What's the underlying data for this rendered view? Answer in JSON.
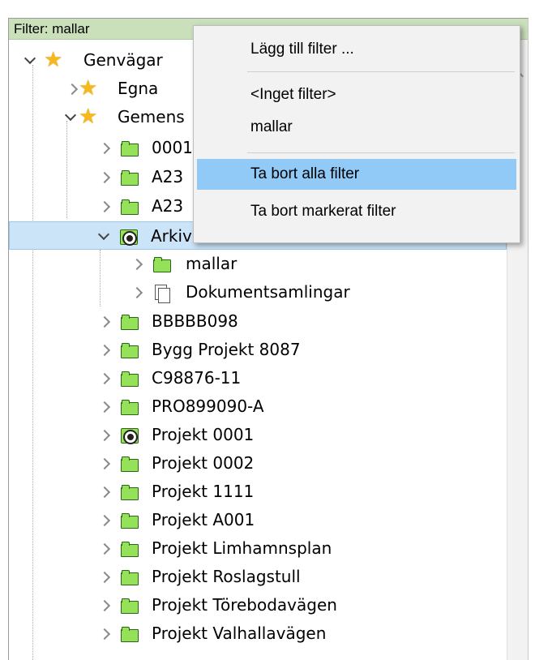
{
  "filter_bar": {
    "text": "Filter: mallar"
  },
  "context_menu": {
    "items": [
      {
        "label": "Lägg till filter ..."
      },
      {
        "label": "<Inget filter>"
      },
      {
        "label": "mallar"
      },
      {
        "label": "Ta bort alla filter",
        "highlighted": true
      },
      {
        "label": "Ta bort markerat filter"
      }
    ]
  },
  "tree": {
    "root": {
      "label": "Genvägar",
      "icon": "star-icon",
      "expanded": true
    },
    "egna": {
      "label": "Egna",
      "icon": "star-icon"
    },
    "gemensamma": {
      "label": "Gemens",
      "icon": "star-icon",
      "expanded": true
    },
    "items_a": [
      {
        "label": "0001"
      },
      {
        "label": "A23"
      },
      {
        "label": "A23"
      }
    ],
    "arkiv": {
      "label": "Arkiv",
      "icon": "filter-folder-icon",
      "expanded": true,
      "selected": true
    },
    "arkiv_children": [
      {
        "label": "mallar",
        "icon": "folder-icon"
      },
      {
        "label": "Dokumentsamlingar",
        "icon": "documents-icon"
      }
    ],
    "items_b": [
      {
        "label": "BBBBB098",
        "icon": "folder-icon"
      },
      {
        "label": "Bygg Projekt 8087",
        "icon": "folder-icon"
      },
      {
        "label": "C98876-11",
        "icon": "folder-icon"
      },
      {
        "label": "PRO899090-A",
        "icon": "folder-icon"
      },
      {
        "label": "Projekt 0001",
        "icon": "filter-folder-icon"
      },
      {
        "label": "Projekt 0002",
        "icon": "folder-icon"
      },
      {
        "label": "Projekt 1111",
        "icon": "folder-icon"
      },
      {
        "label": "Projekt A001",
        "icon": "folder-icon"
      },
      {
        "label": "Projekt Limhamnsplan",
        "icon": "folder-icon"
      },
      {
        "label": "Projekt Roslagstull",
        "icon": "folder-icon"
      },
      {
        "label": "Projekt Törebodavägen",
        "icon": "folder-icon"
      },
      {
        "label": "Projekt Valhallavägen",
        "icon": "folder-icon"
      }
    ]
  },
  "colors": {
    "filter_bar_bg": "#c9e0bb",
    "selection_bg": "#cce4f7",
    "menu_highlight": "#91c9f7",
    "folder_green": "#95e25a",
    "star_yellow": "#f5b91d"
  }
}
